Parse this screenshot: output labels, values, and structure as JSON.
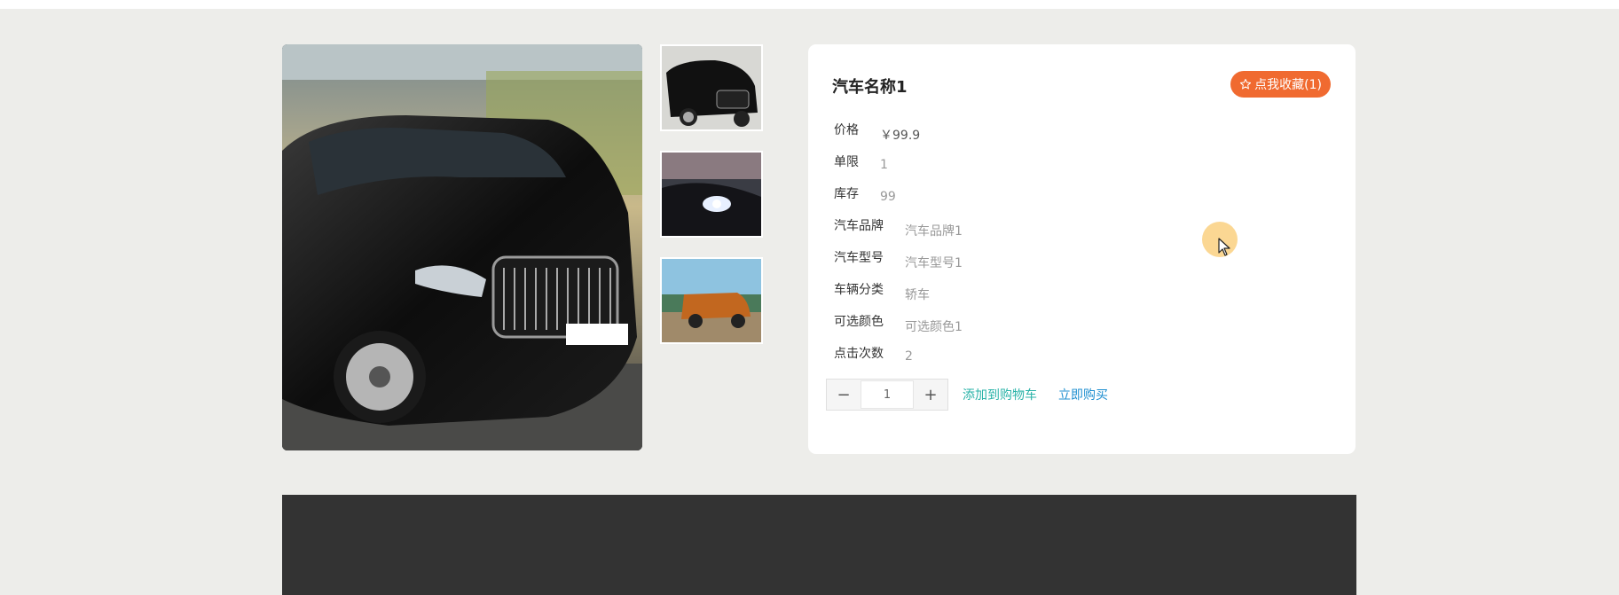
{
  "product": {
    "title": "汽车名称1",
    "favorite_label": "点我收藏(1)",
    "fields": [
      {
        "label": "价格",
        "value": "￥99.9"
      },
      {
        "label": "单限",
        "value": "1"
      },
      {
        "label": "库存",
        "value": "99"
      },
      {
        "label": "汽车品牌",
        "value": "汽车品牌1"
      },
      {
        "label": "汽车型号",
        "value": "汽车型号1"
      },
      {
        "label": "车辆分类",
        "value": "轿车"
      },
      {
        "label": "可选颜色",
        "value": "可选颜色1"
      },
      {
        "label": "点击次数",
        "value": "2"
      }
    ]
  },
  "purchase": {
    "quantity": "1",
    "minus_symbol": "−",
    "plus_symbol": "+",
    "add_to_cart_label": "添加到购物车",
    "buy_now_label": "立即购买"
  },
  "gallery": {
    "main_image": "black-van-photo",
    "thumbnails": [
      "black-van-thumb",
      "headlight-thumb",
      "orange-suv-thumb"
    ]
  },
  "colors": {
    "favorite_button": "#f06a30",
    "add_to_cart": "#2ab3a8",
    "buy_now": "#1f8fd0",
    "footer": "#333333",
    "page_bg": "#ededea"
  }
}
